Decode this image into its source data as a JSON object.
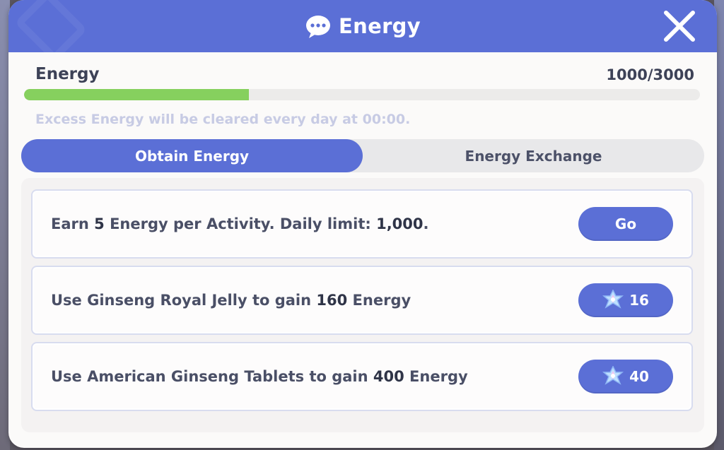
{
  "dialog": {
    "title": "Energy",
    "title_icon": "chat-bubble-icon",
    "close_icon": "close-icon"
  },
  "energy": {
    "label": "Energy",
    "current": 1000,
    "max": 3000,
    "count_text": "1000/3000",
    "fill_fraction": 0.333,
    "notice": "Excess Energy will be cleared every day at 00:00."
  },
  "tabs": [
    {
      "label": "Obtain Energy",
      "active": true
    },
    {
      "label": "Energy Exchange",
      "active": false
    }
  ],
  "tasks": [
    {
      "parts": [
        "Earn ",
        "5",
        " Energy per Activity. Daily limit: ",
        "1,000",
        "."
      ],
      "button_label": "Go",
      "button_icon": ""
    },
    {
      "parts": [
        "Use Ginseng Royal Jelly to gain ",
        "160",
        " Energy",
        "",
        ""
      ],
      "button_label": "16",
      "button_icon": "crystal-icon"
    },
    {
      "parts": [
        "Use American Ginseng Tablets to gain ",
        "400",
        " Energy",
        "",
        ""
      ],
      "button_label": "40",
      "button_icon": "crystal-icon"
    }
  ],
  "colors": {
    "header": "#5b6fd6",
    "progress": "#86d05e",
    "button": "#5b6fd6"
  }
}
